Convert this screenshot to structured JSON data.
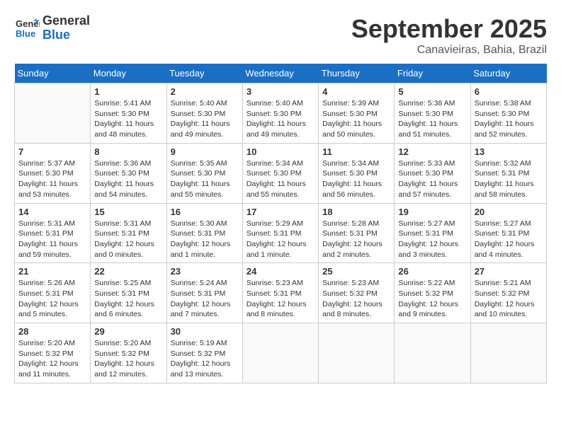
{
  "header": {
    "logo_general": "General",
    "logo_blue": "Blue",
    "month": "September 2025",
    "location": "Canavieiras, Bahia, Brazil"
  },
  "days_of_week": [
    "Sunday",
    "Monday",
    "Tuesday",
    "Wednesday",
    "Thursday",
    "Friday",
    "Saturday"
  ],
  "weeks": [
    [
      {
        "day": "",
        "info": ""
      },
      {
        "day": "1",
        "info": "Sunrise: 5:41 AM\nSunset: 5:30 PM\nDaylight: 11 hours\nand 48 minutes."
      },
      {
        "day": "2",
        "info": "Sunrise: 5:40 AM\nSunset: 5:30 PM\nDaylight: 11 hours\nand 49 minutes."
      },
      {
        "day": "3",
        "info": "Sunrise: 5:40 AM\nSunset: 5:30 PM\nDaylight: 11 hours\nand 49 minutes."
      },
      {
        "day": "4",
        "info": "Sunrise: 5:39 AM\nSunset: 5:30 PM\nDaylight: 11 hours\nand 50 minutes."
      },
      {
        "day": "5",
        "info": "Sunrise: 5:38 AM\nSunset: 5:30 PM\nDaylight: 11 hours\nand 51 minutes."
      },
      {
        "day": "6",
        "info": "Sunrise: 5:38 AM\nSunset: 5:30 PM\nDaylight: 11 hours\nand 52 minutes."
      }
    ],
    [
      {
        "day": "7",
        "info": "Sunrise: 5:37 AM\nSunset: 5:30 PM\nDaylight: 11 hours\nand 53 minutes."
      },
      {
        "day": "8",
        "info": "Sunrise: 5:36 AM\nSunset: 5:30 PM\nDaylight: 11 hours\nand 54 minutes."
      },
      {
        "day": "9",
        "info": "Sunrise: 5:35 AM\nSunset: 5:30 PM\nDaylight: 11 hours\nand 55 minutes."
      },
      {
        "day": "10",
        "info": "Sunrise: 5:34 AM\nSunset: 5:30 PM\nDaylight: 11 hours\nand 55 minutes."
      },
      {
        "day": "11",
        "info": "Sunrise: 5:34 AM\nSunset: 5:30 PM\nDaylight: 11 hours\nand 56 minutes."
      },
      {
        "day": "12",
        "info": "Sunrise: 5:33 AM\nSunset: 5:30 PM\nDaylight: 11 hours\nand 57 minutes."
      },
      {
        "day": "13",
        "info": "Sunrise: 5:32 AM\nSunset: 5:31 PM\nDaylight: 11 hours\nand 58 minutes."
      }
    ],
    [
      {
        "day": "14",
        "info": "Sunrise: 5:31 AM\nSunset: 5:31 PM\nDaylight: 11 hours\nand 59 minutes."
      },
      {
        "day": "15",
        "info": "Sunrise: 5:31 AM\nSunset: 5:31 PM\nDaylight: 12 hours\nand 0 minutes."
      },
      {
        "day": "16",
        "info": "Sunrise: 5:30 AM\nSunset: 5:31 PM\nDaylight: 12 hours\nand 1 minute."
      },
      {
        "day": "17",
        "info": "Sunrise: 5:29 AM\nSunset: 5:31 PM\nDaylight: 12 hours\nand 1 minute."
      },
      {
        "day": "18",
        "info": "Sunrise: 5:28 AM\nSunset: 5:31 PM\nDaylight: 12 hours\nand 2 minutes."
      },
      {
        "day": "19",
        "info": "Sunrise: 5:27 AM\nSunset: 5:31 PM\nDaylight: 12 hours\nand 3 minutes."
      },
      {
        "day": "20",
        "info": "Sunrise: 5:27 AM\nSunset: 5:31 PM\nDaylight: 12 hours\nand 4 minutes."
      }
    ],
    [
      {
        "day": "21",
        "info": "Sunrise: 5:26 AM\nSunset: 5:31 PM\nDaylight: 12 hours\nand 5 minutes."
      },
      {
        "day": "22",
        "info": "Sunrise: 5:25 AM\nSunset: 5:31 PM\nDaylight: 12 hours\nand 6 minutes."
      },
      {
        "day": "23",
        "info": "Sunrise: 5:24 AM\nSunset: 5:31 PM\nDaylight: 12 hours\nand 7 minutes."
      },
      {
        "day": "24",
        "info": "Sunrise: 5:23 AM\nSunset: 5:31 PM\nDaylight: 12 hours\nand 8 minutes."
      },
      {
        "day": "25",
        "info": "Sunrise: 5:23 AM\nSunset: 5:32 PM\nDaylight: 12 hours\nand 8 minutes."
      },
      {
        "day": "26",
        "info": "Sunrise: 5:22 AM\nSunset: 5:32 PM\nDaylight: 12 hours\nand 9 minutes."
      },
      {
        "day": "27",
        "info": "Sunrise: 5:21 AM\nSunset: 5:32 PM\nDaylight: 12 hours\nand 10 minutes."
      }
    ],
    [
      {
        "day": "28",
        "info": "Sunrise: 5:20 AM\nSunset: 5:32 PM\nDaylight: 12 hours\nand 11 minutes."
      },
      {
        "day": "29",
        "info": "Sunrise: 5:20 AM\nSunset: 5:32 PM\nDaylight: 12 hours\nand 12 minutes."
      },
      {
        "day": "30",
        "info": "Sunrise: 5:19 AM\nSunset: 5:32 PM\nDaylight: 12 hours\nand 13 minutes."
      },
      {
        "day": "",
        "info": ""
      },
      {
        "day": "",
        "info": ""
      },
      {
        "day": "",
        "info": ""
      },
      {
        "day": "",
        "info": ""
      }
    ]
  ]
}
